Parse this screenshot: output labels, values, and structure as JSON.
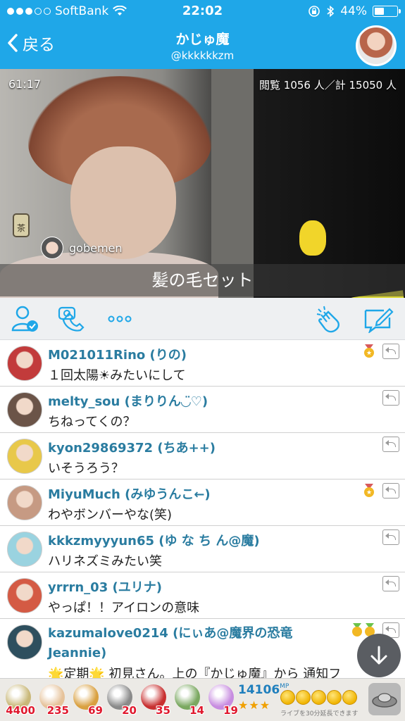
{
  "status_bar": {
    "carrier": "SoftBank",
    "time": "22:02",
    "battery": "44%"
  },
  "nav": {
    "back_label": "戻る",
    "title": "かじゅ魔",
    "handle": "@kkkkkkzm"
  },
  "video": {
    "elapsed": "61:17",
    "viewers": "閲覧 1056 人／計 15050 人",
    "gift_icon_text": "茶",
    "gift_user": "gobemen",
    "caption": "髪の毛セット"
  },
  "comments": [
    {
      "user": "M021011Rino (りの)",
      "text": "１回太陽☀みたいにして",
      "badge": "single",
      "avatar_color": "#c23b3b"
    },
    {
      "user": "melty_sou (まりりん◡̈♡)",
      "text": "ちねってくの？",
      "badge": "none",
      "avatar_color": "#6b5448"
    },
    {
      "user": "kyon29869372 (ちあ++)",
      "text": "いそうろう？",
      "badge": "none",
      "avatar_color": "#e8c84a"
    },
    {
      "user": "MiyuMuch (みゆうんこ←)",
      "text": "わやボンバーやな(笑)",
      "badge": "single",
      "avatar_color": "#c69a83"
    },
    {
      "user": "kkkzmyyyun65 (ゆ な ち ん@魔)",
      "text": "ハリネズミみたい笑",
      "badge": "none",
      "avatar_color": "#9ad3e0"
    },
    {
      "user": "yrrrn_03 (ユリナ)",
      "text": "やっぱ！！アイロンの意味",
      "badge": "none",
      "avatar_color": "#d45a44"
    },
    {
      "user": "kazumalove0214 (にぃあ@魔界の恐竜 Jeannie)",
      "text": "🌟定期🌟 初見さん。上の『かじゅ魔』から 通知フ",
      "badge": "double",
      "avatar_color": "#2e4f5e"
    }
  ],
  "gifts": [
    {
      "count": "4400",
      "color": "#c9b878"
    },
    {
      "count": "235",
      "color": "#e6c29a"
    },
    {
      "count": "69",
      "color": "#d9a040"
    },
    {
      "count": "20",
      "color": "#8a8a8a"
    },
    {
      "count": "35",
      "color": "#c83030"
    },
    {
      "count": "14",
      "color": "#7aa860"
    },
    {
      "count": "19",
      "color": "#c78ce0"
    }
  ],
  "points": {
    "value": "14106",
    "unit": "MP",
    "stars": "★★★",
    "extend_note": "ライブを30分延長できます",
    "coins": 5
  },
  "colors": {
    "header_bg": "#1fa7e8",
    "username": "#2a7ca0",
    "accent_icon": "#1fa7e8"
  }
}
